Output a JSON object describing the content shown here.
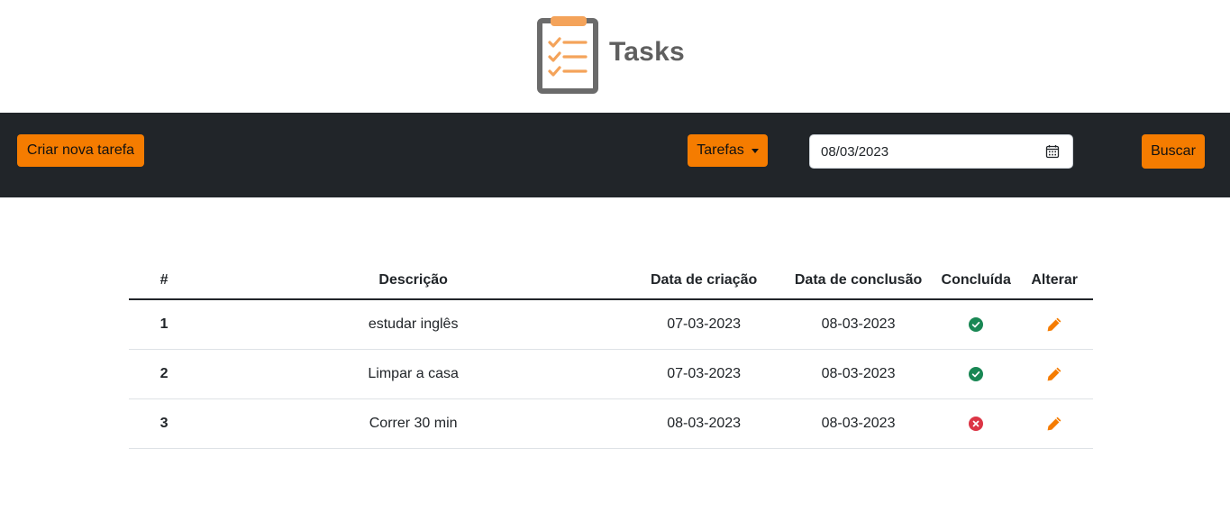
{
  "app": {
    "title": "Tasks",
    "logo_icon": "clipboard-checklist-icon",
    "brand_orange": "#f57c00",
    "brand_gray": "#5f5f5f"
  },
  "navbar": {
    "background": "#212529",
    "new_task_label": "Criar nova tarefa",
    "filter_dropdown_label": "Tarefas",
    "date_value": "08/03/2023",
    "search_label": "Buscar"
  },
  "table": {
    "headers": {
      "index": "#",
      "description": "Descrição",
      "created": "Data de criação",
      "completed_date": "Data de conclusão",
      "done": "Concluída",
      "edit": "Alterar"
    },
    "rows": [
      {
        "index": "1",
        "description": "estudar inglês",
        "created": "07-03-2023",
        "completed_date": "08-03-2023",
        "done": true,
        "done_icon": "check-circle-icon",
        "edit_icon": "pencil-icon"
      },
      {
        "index": "2",
        "description": "Limpar a casa",
        "created": "07-03-2023",
        "completed_date": "08-03-2023",
        "done": true,
        "done_icon": "check-circle-icon",
        "edit_icon": "pencil-icon"
      },
      {
        "index": "3",
        "description": "Correr 30 min",
        "created": "08-03-2023",
        "completed_date": "08-03-2023",
        "done": false,
        "done_icon": "x-circle-icon",
        "edit_icon": "pencil-icon"
      }
    ],
    "status_colors": {
      "done": "#198754",
      "not_done": "#dc3545"
    }
  }
}
